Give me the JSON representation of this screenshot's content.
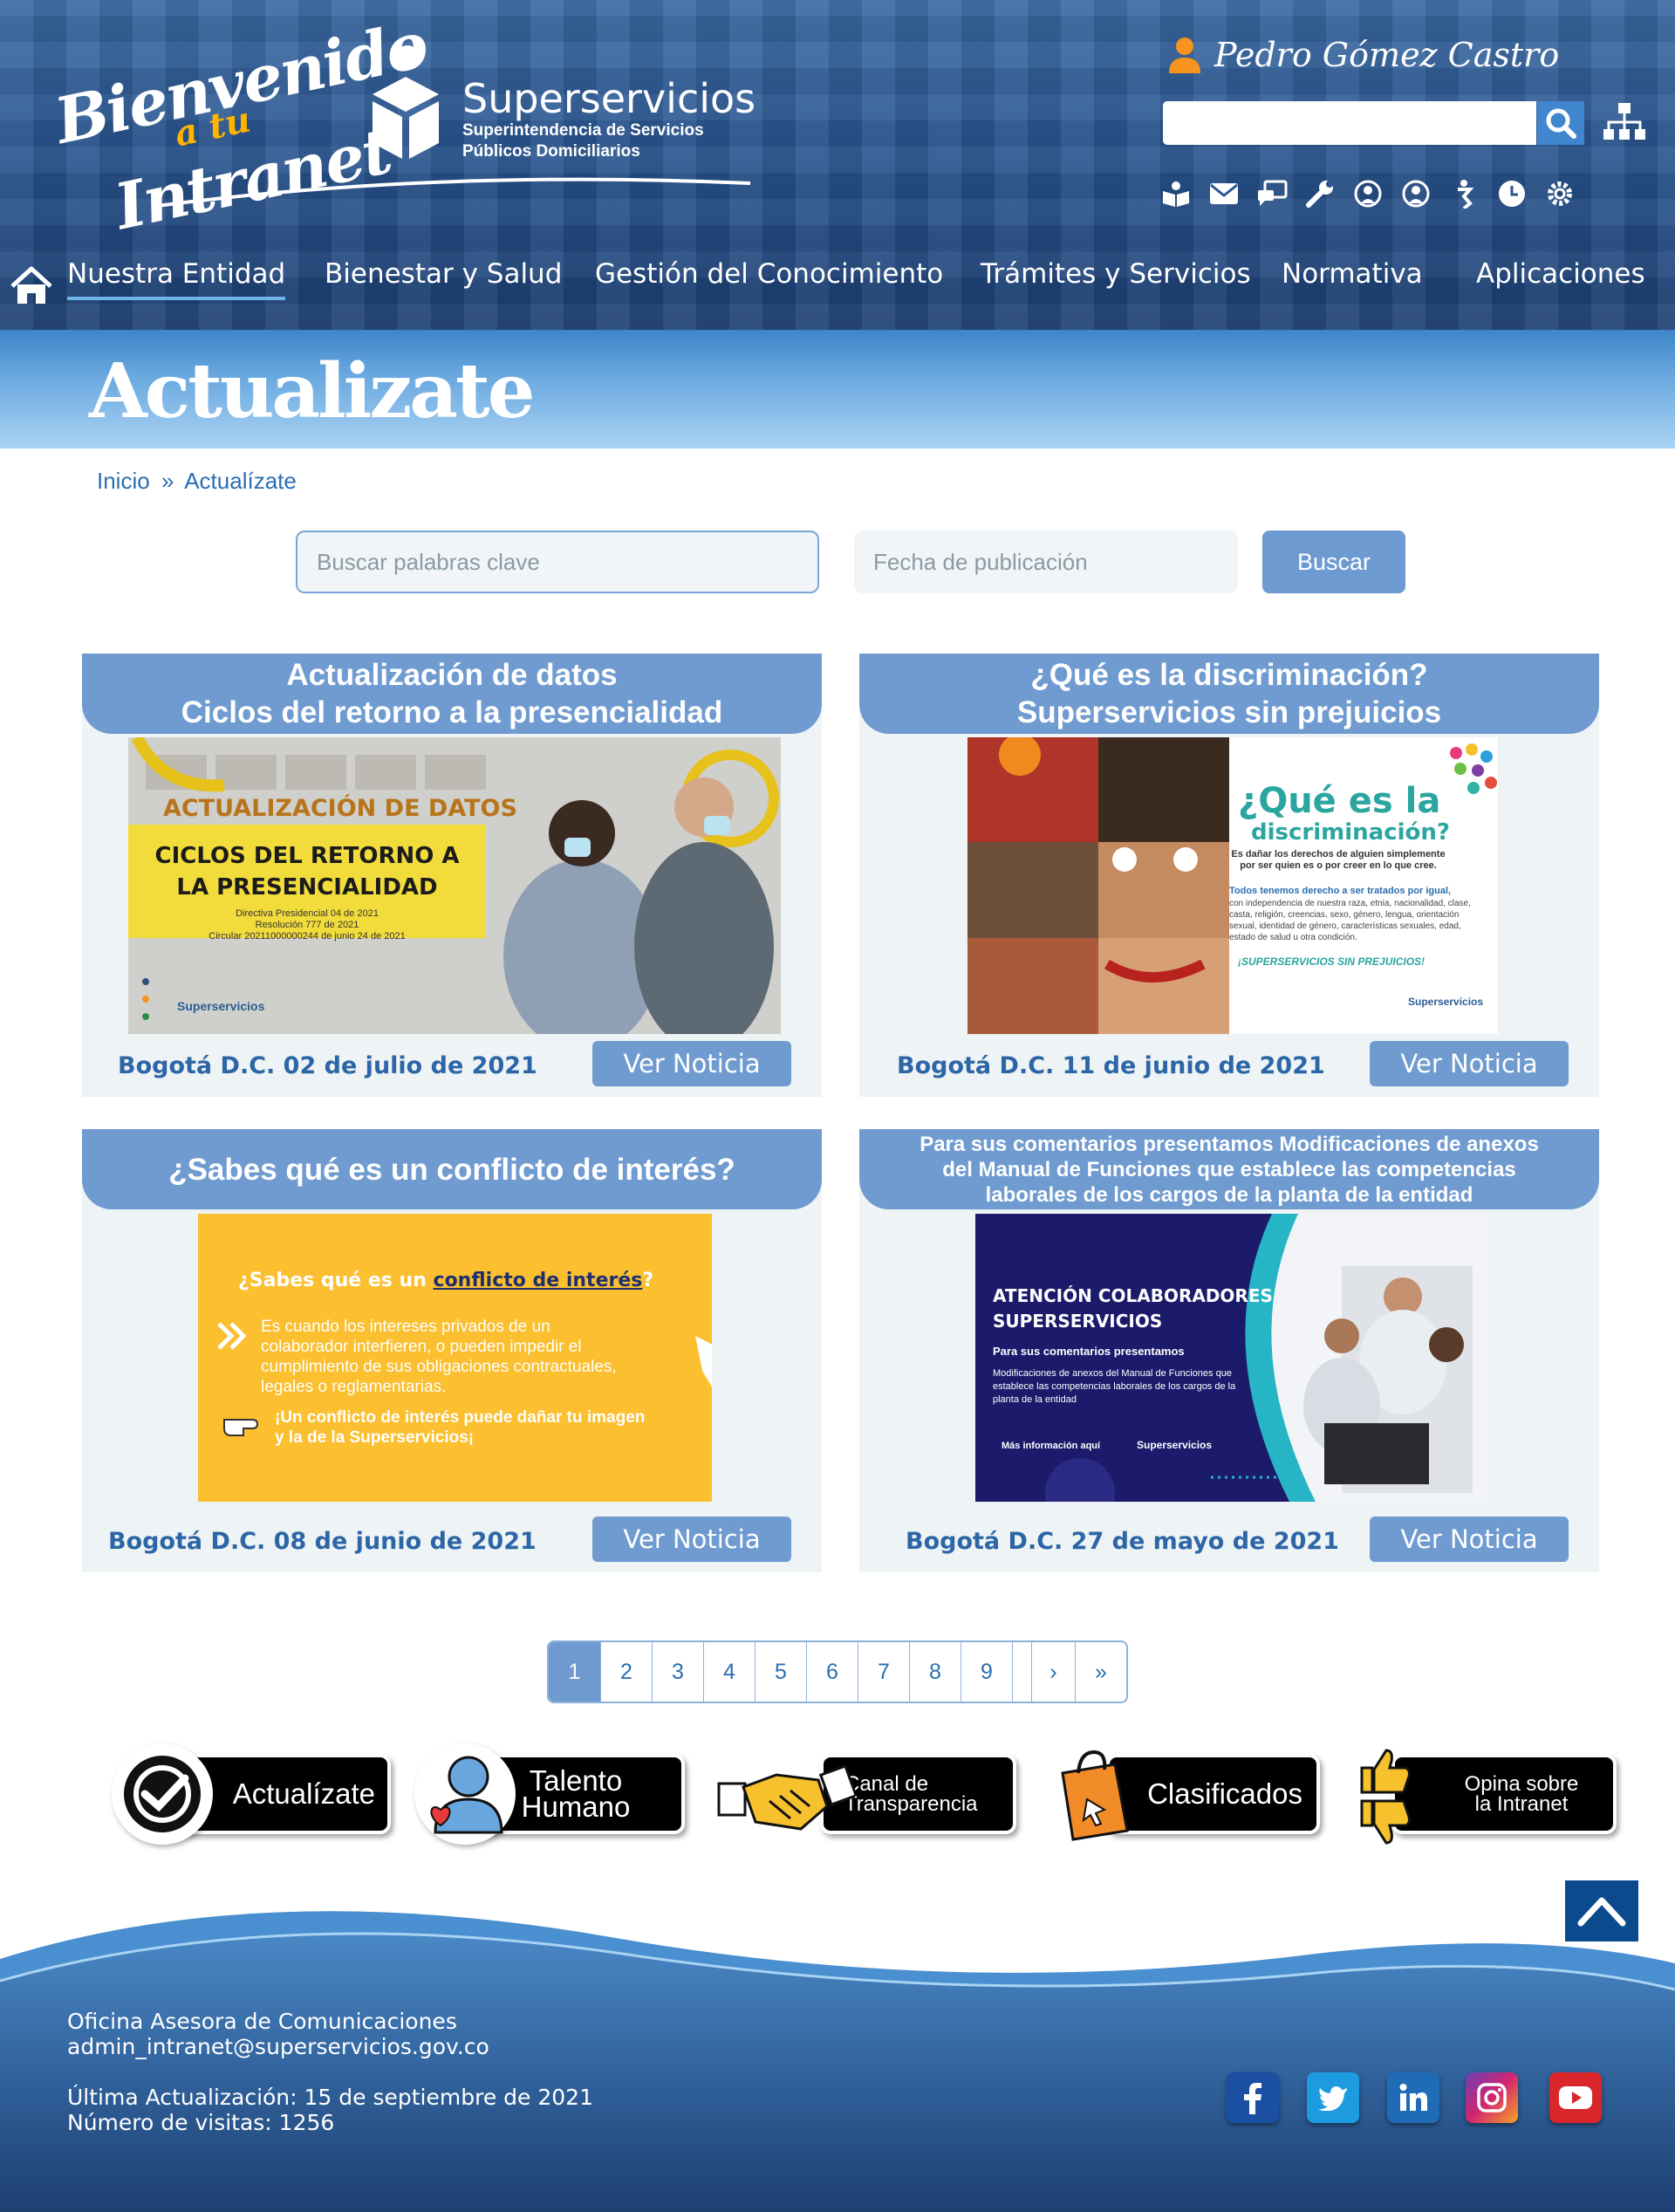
{
  "header": {
    "welcome": [
      "Bienvenido",
      "a tu",
      "Intranet"
    ],
    "logo_name": "Superservicios",
    "logo_sub": [
      "Superintendencia de Servicios",
      "Públicos Domiciliarios"
    ],
    "user_name": "Pedro Gómez Castro",
    "toolbar_icons": [
      "book-icon",
      "mail-icon",
      "chat-icon",
      "wrench-icon",
      "support-icon",
      "support-alt-icon",
      "accessibility-icon",
      "clock-icon",
      "settings-icon"
    ]
  },
  "nav": {
    "items": [
      "Nuestra Entidad",
      "Bienestar y Salud",
      "Gestión del Conocimiento",
      "Trámites y Servicios",
      "Normativa",
      "Aplicaciones"
    ]
  },
  "banner": {
    "title": "Actualizate"
  },
  "breadcrumb": {
    "home": "Inicio",
    "separator": "»",
    "current": "Actualízate"
  },
  "filters": {
    "keyword_placeholder": "Buscar palabras clave",
    "date_placeholder": "Fecha de publicación",
    "search_label": "Buscar"
  },
  "cards": [
    {
      "title": [
        "Actualización de datos",
        "Ciclos del retorno a la presencialidad"
      ],
      "date": "Bogotá D.C. 02 de julio de 2021",
      "button": "Ver Noticia",
      "image_text": {
        "top": "ACTUALIZACIÓN DE DATOS",
        "main": [
          "CICLOS DEL RETORNO A",
          "LA PRESENCIALIDAD"
        ],
        "small": [
          "Directiva Presidencial 04 de 2021",
          "Resolución 777 de 2021",
          "Circular 20211000000244 de junio 24 de 2021"
        ],
        "brand": "Superservicios"
      }
    },
    {
      "title": [
        "¿Qué es la discriminación?",
        "Superservicios sin prejuicios"
      ],
      "date": "Bogotá D.C. 11 de junio de 2021",
      "button": "Ver Noticia",
      "image_text": {
        "big": "¿Qué es la",
        "big2": "discriminación?",
        "p1": "Es dañar los derechos de alguien simplemente por ser quien es o por creer en lo que cree.",
        "p2": "Todos tenemos derecho a ser tratados por igual,",
        "p3": "con independencia de nuestra raza, etnia, nacionalidad, clase, casta, religión, creencias, sexo, género, lengua, orientación sexual, identidad de género, características sexuales, edad, estado de salud u otra condición.",
        "slogan": "¡SUPERSERVICIOS SIN PREJUICIOS!",
        "brand": "Superservicios"
      }
    },
    {
      "title": [
        "¿Sabes qué es un conflicto de interés?"
      ],
      "date": "Bogotá D.C. 08 de junio de 2021",
      "button": "Ver Noticia",
      "image_text": {
        "q_pre": "¿Sabes qué es un ",
        "q_link": "conflicto de interés",
        "q_post": "?",
        "body": "Es cuando los intereses privados de un colaborador interfieren, o pueden impedir el cumplimiento de sus obligaciones contractuales, legales o reglamentarias.",
        "warning": "¡Un conflicto de interés puede dañar tu imagen y la de la Superservicios¡"
      }
    },
    {
      "title": [
        "Para sus comentarios presentamos Modificaciones de anexos",
        "del Manual de Funciones que establece las competencias",
        "laborales de los cargos de la planta de la entidad"
      ],
      "date": "Bogotá D.C. 27 de mayo de 2021",
      "button": "Ver Noticia",
      "image_text": {
        "head": [
          "ATENCIÓN COLABORADORES",
          "SUPERSERVICIOS"
        ],
        "sub": "Para sus comentarios presentamos",
        "body": "Modificaciones de anexos del Manual de Funciones que establece las competencias laborales de los cargos de la planta de la entidad",
        "more": "Más información aquí",
        "brand": "Superservicios"
      }
    }
  ],
  "pagination": {
    "pages": [
      "1",
      "2",
      "3",
      "4",
      "5",
      "6",
      "7",
      "8",
      "9"
    ],
    "active": "1",
    "next": "›",
    "last": "»"
  },
  "quick_links": {
    "actualizate": "Actualízate",
    "talento": [
      "Talento",
      "Humano"
    ],
    "transparencia": [
      "Canal de",
      "Transparencia"
    ],
    "clasificados": "Clasificados",
    "opina": [
      "Opina sobre",
      "la Intranet"
    ]
  },
  "footer": {
    "office": "Oficina Asesora de Comunicaciones",
    "email": "admin_intranet@superservicios.gov.co",
    "updated": "Última Actualización: 15 de septiembre de 2021",
    "visits": "Número de visitas: 1256"
  },
  "colors": {
    "brand_blue": "#2b5d94",
    "accent_blue": "#6f9bd0",
    "orange": "#f7931e",
    "facebook": "#1a4fa3",
    "twitter": "#1d9be0",
    "linkedin": "#1f6bb5",
    "instagram": "#c02c7a",
    "youtube": "#d8262b"
  }
}
